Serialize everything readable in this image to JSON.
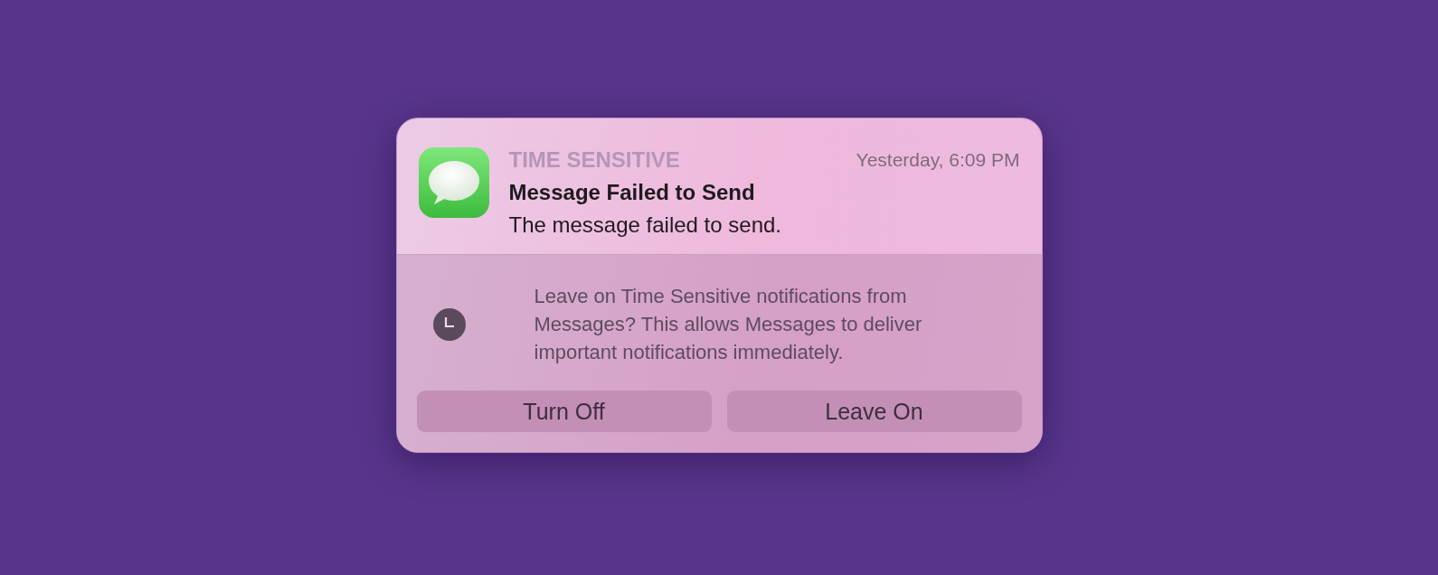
{
  "notification": {
    "category": "TIME SENSITIVE",
    "time": "Yesterday, 6:09 PM",
    "title": "Message Failed to Send",
    "body": "The message failed to send."
  },
  "prompt": {
    "text": "Leave on Time Sensitive notifications from Messages? This allows Messages to deliver important notifications immediately."
  },
  "buttons": [
    "Turn Off",
    "Leave On"
  ]
}
